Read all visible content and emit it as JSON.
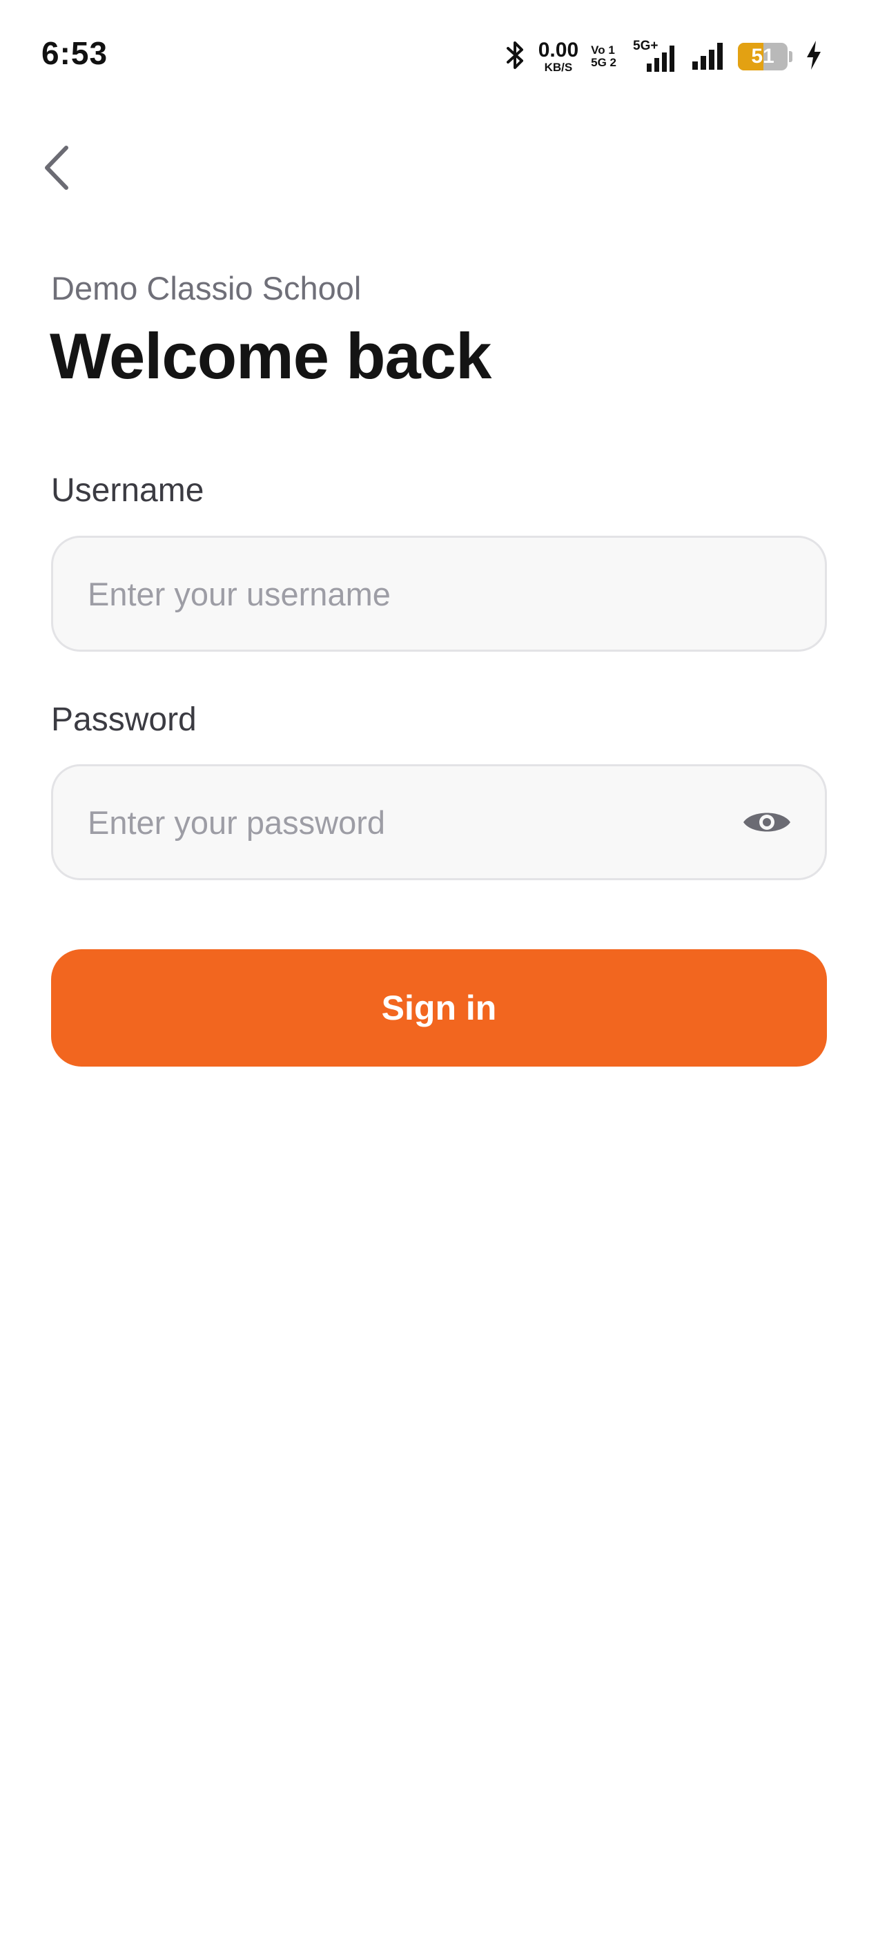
{
  "status_bar": {
    "time": "6:53",
    "net_speed_value": "0.00",
    "net_speed_unit": "KB/S",
    "volte_top": "Vo 1",
    "volte_bottom": "5G 2",
    "network_type": "5G+",
    "battery_level": "51",
    "battery_fraction": 0.51,
    "charging": true,
    "icons": [
      "bluetooth-icon",
      "volte-icon",
      "signal-5g-icon",
      "signal-icon",
      "battery-icon",
      "charging-bolt-icon"
    ]
  },
  "header": {
    "back_icon": "chevron-left-icon",
    "school_name": "Demo Classio School",
    "title": "Welcome back"
  },
  "form": {
    "username": {
      "label": "Username",
      "placeholder": "Enter your username",
      "value": ""
    },
    "password": {
      "label": "Password",
      "placeholder": "Enter your password",
      "value": "",
      "toggle_icon": "eye-icon"
    },
    "submit_label": "Sign in"
  },
  "colors": {
    "accent": "#f2661f",
    "battery": "#e3a112",
    "field_background": "#f8f8f8",
    "field_border": "#e3e3e6",
    "muted_text": "#6f6f78",
    "placeholder": "#9d9da5"
  }
}
